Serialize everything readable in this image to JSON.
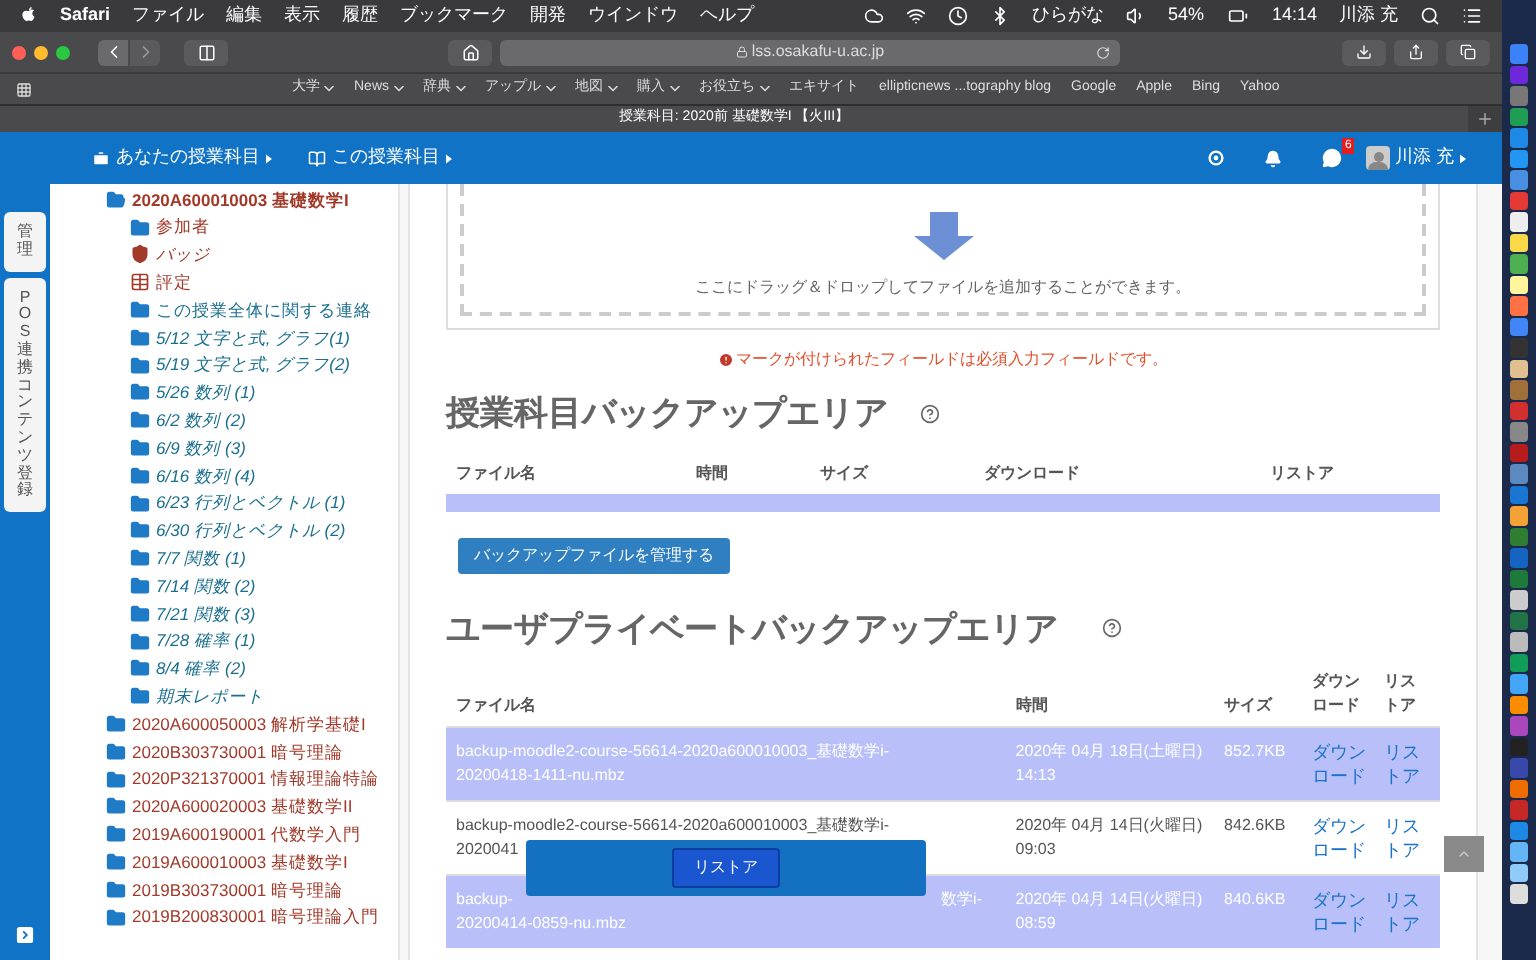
{
  "menu_bar": {
    "app": "Safari",
    "items": [
      "ファイル",
      "編集",
      "表示",
      "履歴",
      "ブックマーク",
      "開発",
      "ウインドウ",
      "ヘルプ"
    ],
    "input_method": "ひらがな",
    "battery": "54%",
    "time": "14:14",
    "user": "川添 充"
  },
  "browser": {
    "address": "lss.osakafu-u.ac.jp",
    "bookmarks": [
      {
        "label": "大学",
        "menu": true
      },
      {
        "label": "News",
        "menu": true
      },
      {
        "label": "辞典",
        "menu": true
      },
      {
        "label": "アップル",
        "menu": true
      },
      {
        "label": "地図",
        "menu": true
      },
      {
        "label": "購入",
        "menu": true
      },
      {
        "label": "お役立ち",
        "menu": true
      },
      {
        "label": "エキサイト",
        "menu": false
      },
      {
        "label": "ellipticnews ...tography blog",
        "menu": false
      },
      {
        "label": "Google",
        "menu": false
      },
      {
        "label": "Apple",
        "menu": false
      },
      {
        "label": "Bing",
        "menu": false
      },
      {
        "label": "Yahoo",
        "menu": false
      }
    ],
    "tab_title": "授業科目: 2020前 基礎数学I 【火III】"
  },
  "nav": {
    "items": [
      "あなたの授業科目",
      "この授業科目"
    ],
    "message_count": "6",
    "user": "川添 充"
  },
  "side_tabs": [
    "管理",
    "POS連携コンテンツ登録"
  ],
  "tree": [
    {
      "label": "2020A600010003 基礎数学I",
      "kind": "course",
      "expanded": true,
      "children": [
        {
          "label": "参加者",
          "kind": "participants"
        },
        {
          "label": "バッジ",
          "kind": "badges"
        },
        {
          "label": "評定",
          "kind": "grades"
        },
        {
          "label": "この授業全体に関する連絡",
          "kind": "topic"
        },
        {
          "label": "5/12 文字と式, グラフ(1)",
          "kind": "section"
        },
        {
          "label": "5/19 文字と式, グラフ(2)",
          "kind": "section"
        },
        {
          "label": "5/26 数列 (1)",
          "kind": "section"
        },
        {
          "label": "6/2 数列 (2)",
          "kind": "section"
        },
        {
          "label": "6/9 数列 (3)",
          "kind": "section"
        },
        {
          "label": "6/16 数列 (4)",
          "kind": "section"
        },
        {
          "label": "6/23 行列とベクトル (1)",
          "kind": "section"
        },
        {
          "label": "6/30 行列とベクトル (2)",
          "kind": "section"
        },
        {
          "label": "7/7 関数 (1)",
          "kind": "section"
        },
        {
          "label": "7/14 関数 (2)",
          "kind": "section"
        },
        {
          "label": "7/21 関数 (3)",
          "kind": "section"
        },
        {
          "label": "7/28 確率 (1)",
          "kind": "section"
        },
        {
          "label": "8/4 確率 (2)",
          "kind": "section"
        },
        {
          "label": "期末レポート",
          "kind": "section"
        }
      ]
    },
    {
      "label": "2020A600050003 解析学基礎I",
      "kind": "course",
      "expanded": false
    },
    {
      "label": "2020B303730001 暗号理論",
      "kind": "course",
      "expanded": false
    },
    {
      "label": "2020P321370001 情報理論特論",
      "kind": "course",
      "expanded": false
    },
    {
      "label": "2020A600020003 基礎数学II",
      "kind": "course",
      "expanded": false
    },
    {
      "label": "2019A600190001 代数学入門",
      "kind": "course",
      "expanded": false
    },
    {
      "label": "2019A600010003 基礎数学I",
      "kind": "course",
      "expanded": false
    },
    {
      "label": "2019B303730001 暗号理論",
      "kind": "course",
      "expanded": false
    },
    {
      "label": "2019B200830001 暗号理論入門",
      "kind": "course",
      "expanded": false
    }
  ],
  "dropzone": {
    "text": "ここにドラッグ＆ドロップしてファイルを追加することができます。"
  },
  "required_note": "マークが付けられたフィールドは必須入力フィールドです。",
  "course_backup": {
    "title": "授業科目バックアップエリア",
    "columns": [
      "ファイル名",
      "時間",
      "サイズ",
      "ダウンロード",
      "リストア"
    ],
    "manage_button": "バックアップファイルを管理する"
  },
  "user_backup": {
    "title": "ユーザプライベートバックアップエリア",
    "columns": [
      "ファイル名",
      "時間",
      "サイズ",
      "ダウンロード",
      "リストア"
    ],
    "rows": [
      {
        "highlighted": true,
        "name": [
          "backup-moodle2-course-56614-2020a600010003_基礎数学i-",
          "20200418-1411-nu.mbz"
        ],
        "time": "2020年 04月 18日(土曜日) 14:13",
        "size": "852.7KB",
        "download": "ダウンロード",
        "restore": "リストア"
      },
      {
        "highlighted": false,
        "name": [
          "backup-moodle2-course-56614-2020a600010003_基礎数学i-",
          "2020041"
        ],
        "time": "2020年 04月 14日(火曜日) 09:03",
        "size": "842.6KB",
        "download": "ダウンロード",
        "restore": "リストア"
      },
      {
        "highlighted": true,
        "name": [
          "backup-",
          "数学i-",
          "20200414-0859-nu.mbz"
        ],
        "time": "2020年 04月 14日(火曜日) 08:59",
        "size": "840.6KB",
        "download": "ダウンロード",
        "restore": "リストア"
      }
    ]
  },
  "restore_bar": {
    "button": "リストア"
  }
}
